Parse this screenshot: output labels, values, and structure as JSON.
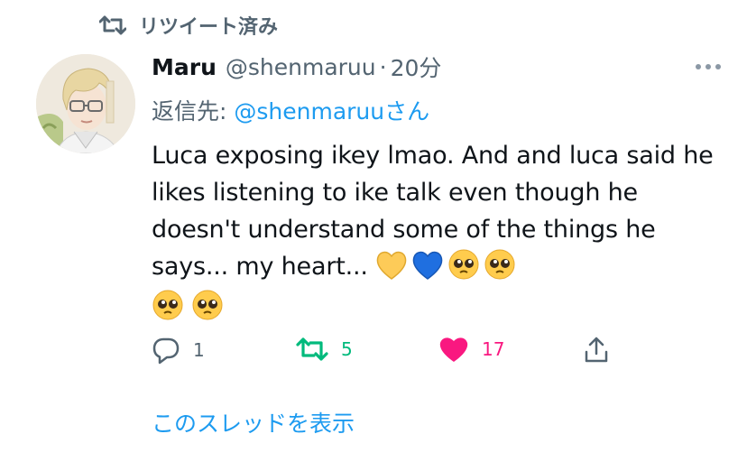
{
  "retweet_banner": {
    "icon": "retweet-icon",
    "label": "リツイート済み"
  },
  "tweet": {
    "author_name": "Maru",
    "handle": "@shenmaruu",
    "separator": "·",
    "time": "20分",
    "reply_prefix": "返信先: ",
    "reply_to": "@shenmaruu",
    "reply_suffix": "さん",
    "text": "Luca exposing ikey lmao. And and luca said he likes listening to ike talk even though he doesn't understand some of the things he says... my heart...",
    "emojis": [
      "yellow-heart",
      "blue-heart",
      "pleading-face",
      "pleading-face",
      "pleading-face",
      "pleading-face"
    ]
  },
  "actions": {
    "reply_count": "1",
    "retweet_count": "5",
    "like_count": "17"
  },
  "show_thread": "このスレッドを表示",
  "colors": {
    "text": "#0f1419",
    "secondary": "#536471",
    "link": "#1d9bf0",
    "retweet": "#00ba7c",
    "like": "#f91880"
  }
}
